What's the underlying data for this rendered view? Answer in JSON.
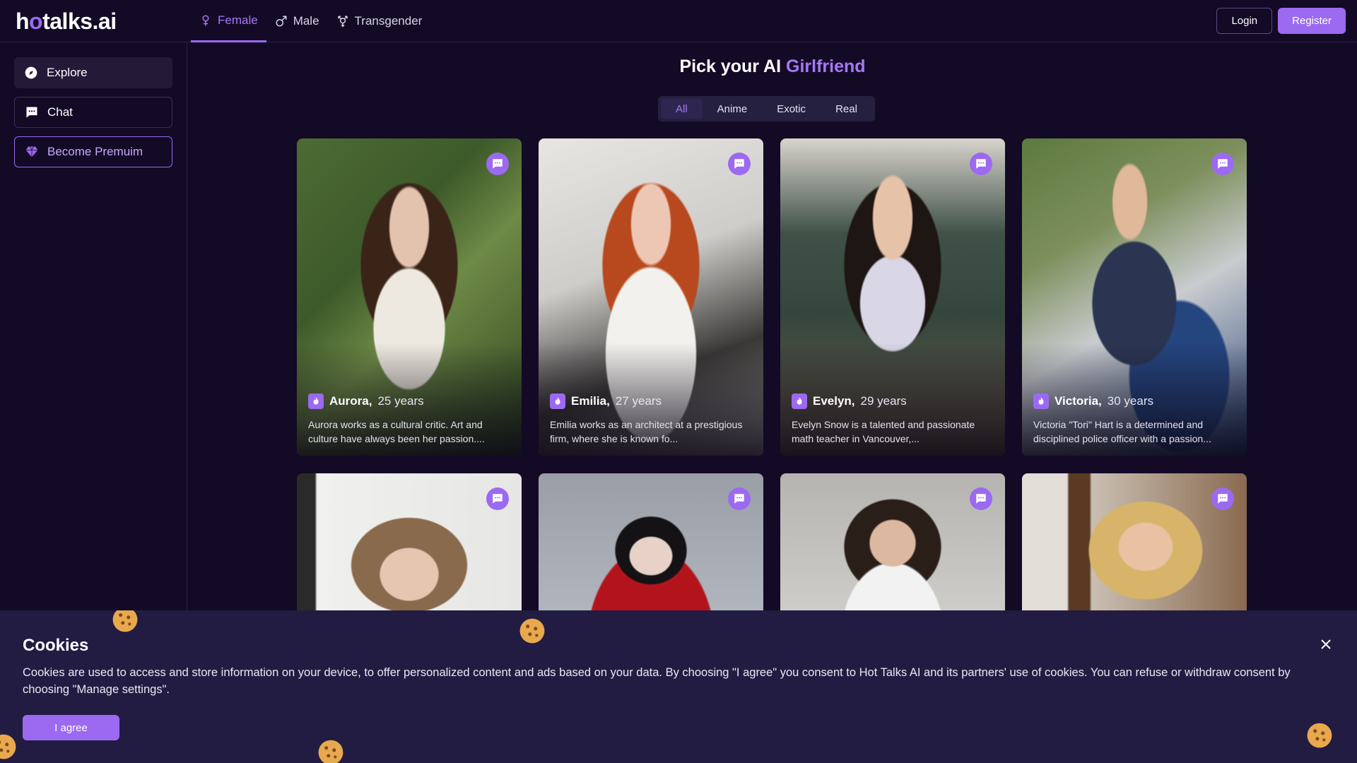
{
  "brand": {
    "logo_prefix": "h",
    "logo_mark": "o",
    "logo_suffix": "talks.ai"
  },
  "gender_tabs": [
    {
      "label": "Female",
      "icon": "female-icon",
      "active": true
    },
    {
      "label": "Male",
      "icon": "male-icon",
      "active": false
    },
    {
      "label": "Transgender",
      "icon": "transgender-icon",
      "active": false
    }
  ],
  "auth": {
    "login_label": "Login",
    "register_label": "Register"
  },
  "sidebar": {
    "items": [
      {
        "label": "Explore",
        "icon": "compass-icon"
      },
      {
        "label": "Chat",
        "icon": "chat-icon"
      },
      {
        "label": "Become Premuim",
        "icon": "diamond-icon"
      }
    ]
  },
  "heading": {
    "prefix": "Pick your AI",
    "accent": "Girlfriend"
  },
  "filters": [
    {
      "label": "All",
      "active": true
    },
    {
      "label": "Anime",
      "active": false
    },
    {
      "label": "Exotic",
      "active": false
    },
    {
      "label": "Real",
      "active": false
    }
  ],
  "cards": [
    {
      "name": "Aurora,",
      "age": "25 years",
      "desc": "Aurora works as a cultural critic. Art and culture have always been her passion...."
    },
    {
      "name": "Emilia,",
      "age": "27 years",
      "desc": "Emilia works as an architect at a prestigious firm, where she is known fo..."
    },
    {
      "name": "Evelyn,",
      "age": "29 years",
      "desc": "Evelyn Snow is a talented and passionate math teacher in Vancouver,..."
    },
    {
      "name": "Victoria,",
      "age": "30 years",
      "desc": "Victoria \"Tori\" Hart is a determined and disciplined police officer with a passion..."
    },
    {
      "name": "",
      "age": "",
      "desc": ""
    },
    {
      "name": "",
      "age": "",
      "desc": ""
    },
    {
      "name": "",
      "age": "",
      "desc": ""
    },
    {
      "name": "",
      "age": "",
      "desc": ""
    }
  ],
  "cookies": {
    "title": "Cookies",
    "text": "Cookies are used to access and store information on your device, to offer personalized content and ads based on your data. By choosing \"I agree\" you consent to Hot Talks AI and its partners' use of cookies. You can refuse or withdraw consent by choosing \"Manage settings\".",
    "agree_label": "I agree"
  },
  "colors": {
    "accent": "#9b6af0",
    "background": "#130a26",
    "banner": "#221c42"
  }
}
